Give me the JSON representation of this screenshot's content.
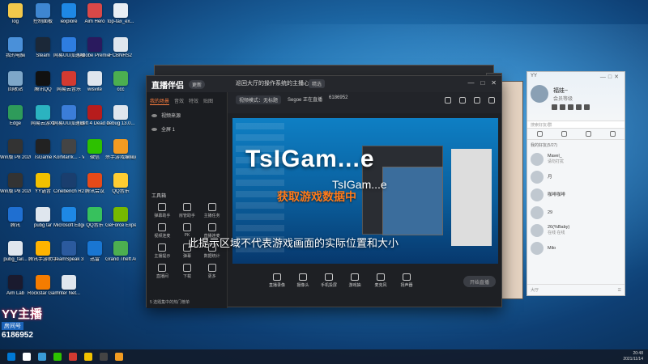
{
  "desktop": {
    "icons": [
      {
        "label": "log",
        "color": "#f2c84b"
      },
      {
        "label": "控制面板",
        "color": "#3e86d1"
      },
      {
        "label": "iexplore",
        "color": "#1e88e5"
      },
      {
        "label": "Aim Hero",
        "color": "#d94848"
      },
      {
        "label": "top-tax_ex...",
        "color": "#e8eef5"
      },
      {
        "label": "我的电脑",
        "color": "#4a90d9"
      },
      {
        "label": "Steam",
        "color": "#1b2838"
      },
      {
        "label": "网易UU加速器",
        "color": "#2e7de0"
      },
      {
        "label": "Adobe Premie...",
        "color": "#2a1a5e"
      },
      {
        "label": "FCBNRS2",
        "color": "#dfe6ee"
      },
      {
        "label": "回收站",
        "color": "#7ea7c9"
      },
      {
        "label": "腾讯QQ",
        "color": "#111111"
      },
      {
        "label": "网易云音乐",
        "color": "#d33a31"
      },
      {
        "label": "wisvite",
        "color": "#dfe6ee"
      },
      {
        "label": "ccc",
        "color": "#4caf50"
      },
      {
        "label": "Edge",
        "color": "#2e9b5a"
      },
      {
        "label": "网易云游戏",
        "color": "#2bb3c0"
      },
      {
        "label": "网易UU加速器",
        "color": "#3b7dd8"
      },
      {
        "label": "Left 4 Dead 2",
        "color": "#b71c1c"
      },
      {
        "label": "debug 13.0...",
        "color": "#dfe6ee"
      },
      {
        "label": "Win版 P8 2020 启动",
        "color": "#333333"
      },
      {
        "label": "TsGame",
        "color": "#222222"
      },
      {
        "label": "KorMarrk... - Verreal...",
        "color": "#444444"
      },
      {
        "label": "微信",
        "color": "#2dc100"
      },
      {
        "label": "杀手游戏编辑器",
        "color": "#f29b21"
      },
      {
        "label": "Win版 P8 2020 启动",
        "color": "#333333"
      },
      {
        "label": "YY语音",
        "color": "#f2c100"
      },
      {
        "label": "Cinebench R20",
        "color": "#1a3e6e"
      },
      {
        "label": "腾讯会议",
        "color": "#e64a19"
      },
      {
        "label": "QQ音乐",
        "color": "#ffcd32"
      },
      {
        "label": "腾讯",
        "color": "#1f6fd1"
      },
      {
        "label": "pubg tar",
        "color": "#dfe6ee"
      },
      {
        "label": "Microsoft Edge",
        "color": "#1e88e5"
      },
      {
        "label": "QQ音乐",
        "color": "#37c15d"
      },
      {
        "label": "GeForce Experience",
        "color": "#76b900"
      },
      {
        "label": "pubg_fail...",
        "color": "#dfe6ee"
      },
      {
        "label": "腾讯手游助手",
        "color": "#ffb300"
      },
      {
        "label": "TeamSpeak 3",
        "color": "#2b5a9e"
      },
      {
        "label": "迅雷",
        "color": "#1976d2"
      },
      {
        "label": "Grand Theft Auto V",
        "color": "#4caf50"
      },
      {
        "label": "Aim Lab",
        "color": "#1a1a2e"
      },
      {
        "label": "Rockstar Games...",
        "color": "#f57c00"
      },
      {
        "label": "Inter Net...",
        "color": "#dfe6ee"
      }
    ]
  },
  "app": {
    "logo": "直播伴侣",
    "version": "更新",
    "room_title": "巡回大厅的操作系统的主播心得",
    "room_tag": "精选",
    "sidebar_tabs": [
      "我的场景",
      "音效",
      "特效",
      "贴图"
    ],
    "scenes": [
      "视频来源",
      "全屏 1"
    ],
    "tools_header": "工具箱",
    "tools": [
      "弹幕助手",
      "房管助手",
      "主播任务",
      "视频连麦",
      "PK",
      "直播连麦",
      "主播提示",
      "弹幕",
      "数据统计",
      "直播间",
      "下载",
      "更多"
    ],
    "sidebar_bottom": "5 选题集中的热门榜单",
    "stage_info": [
      "视频模式：无标题",
      "Segoe 正在直播",
      "6186952"
    ],
    "stage_title": "TsIGam...e",
    "stage_subtitle": "TsIGam...e",
    "game_data_text": "获取游戏数据中",
    "hint_text": "此提示区域不代表游戏画面的实际位置和大小",
    "controls": [
      "直播录像",
      "摄像头",
      "手机投屏",
      "游戏抽",
      "麦克风",
      "扬声器"
    ],
    "start_live": "开始直播"
  },
  "chat": {
    "app_name": "YY",
    "user_name": "福娃~",
    "user_sub": "会员等级",
    "search_placeholder": "搜索好友/群",
    "group_header": "我的好友(5/27)",
    "contacts": [
      {
        "name": "Mavel_",
        "msg": "请勿打扰"
      },
      {
        "name": "月",
        "msg": ""
      },
      {
        "name": "咖啡咖啡",
        "msg": ""
      },
      {
        "name": "29",
        "msg": ""
      },
      {
        "name": "26(%Baby)",
        "msg": "在线 在线"
      },
      {
        "name": "Milo",
        "msg": ""
      }
    ],
    "footer_label": "大厅"
  },
  "badge": {
    "brand": "YY主播",
    "room_label": "房间号",
    "room_number": "6186952"
  },
  "taskbar": {
    "items": [
      "#0078d4",
      "#ffffff",
      "#3a9ad6",
      "#2dc100",
      "#d33a31",
      "#f2c100",
      "#444444",
      "#f29b21"
    ],
    "time": "20:48",
    "date": "2021/11/14"
  }
}
